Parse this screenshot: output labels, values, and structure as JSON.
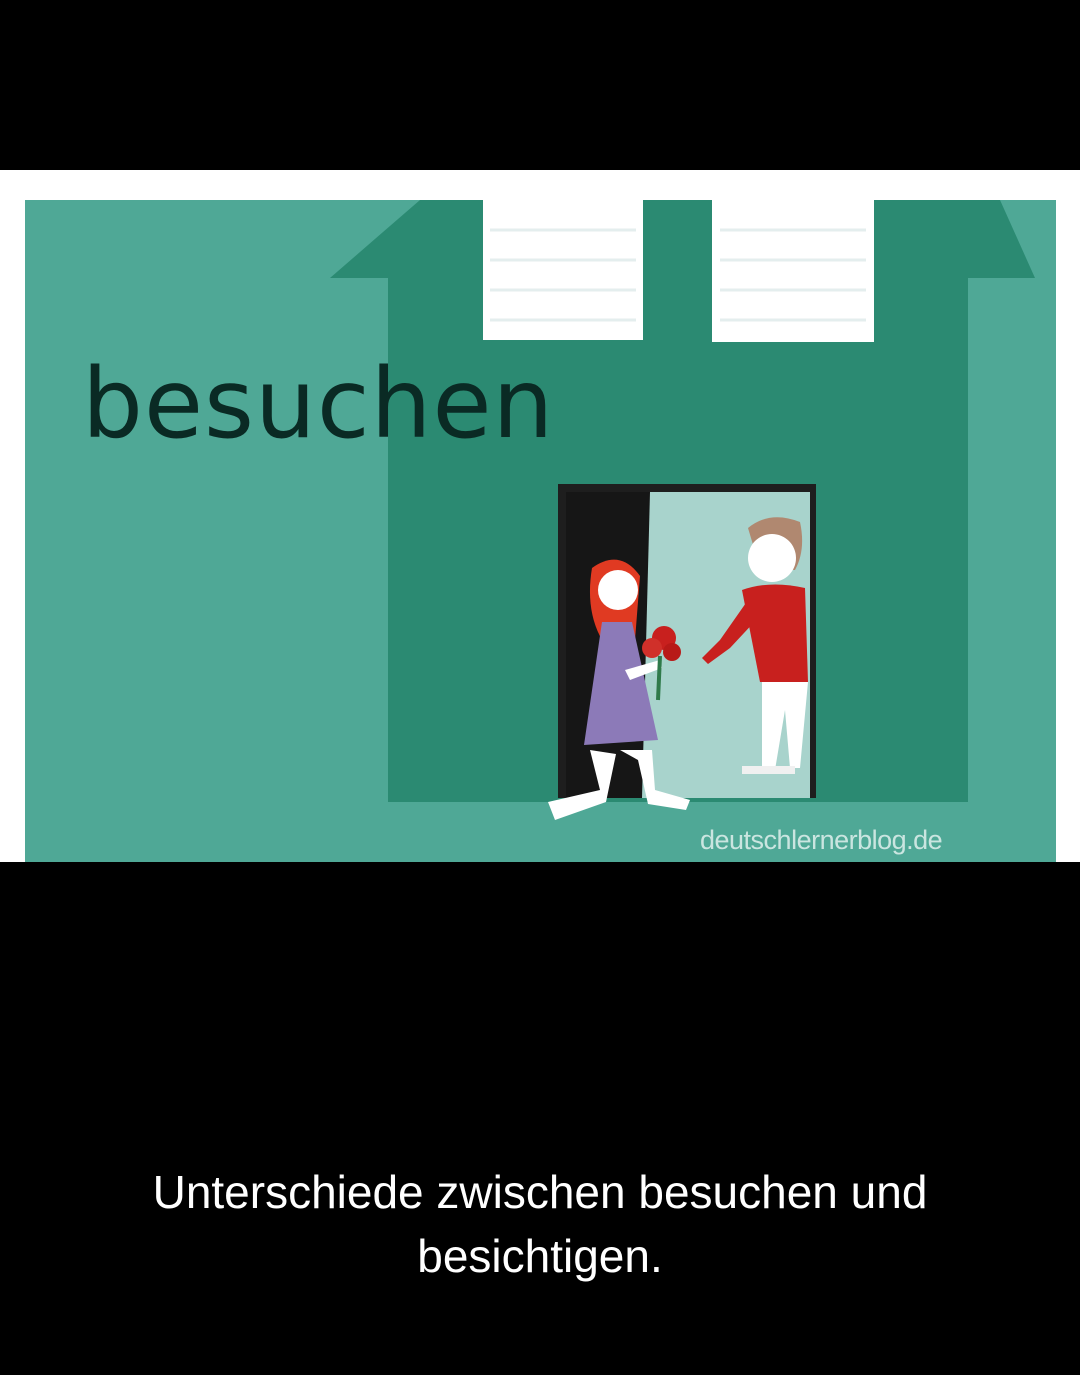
{
  "image": {
    "headline": "besuchen",
    "watermark": "deutschlernerblog.de",
    "colors": {
      "background": "#4fa896",
      "house": "#2b8a72",
      "door_light": "#a8d3cc",
      "shutters": "#ffffff",
      "girl_dress": "#8c7ab8",
      "girl_hair": "#e03a22",
      "boy_shirt": "#c8201e"
    }
  },
  "caption": {
    "text": "Unterschiede zwischen besuchen und besichtigen."
  }
}
